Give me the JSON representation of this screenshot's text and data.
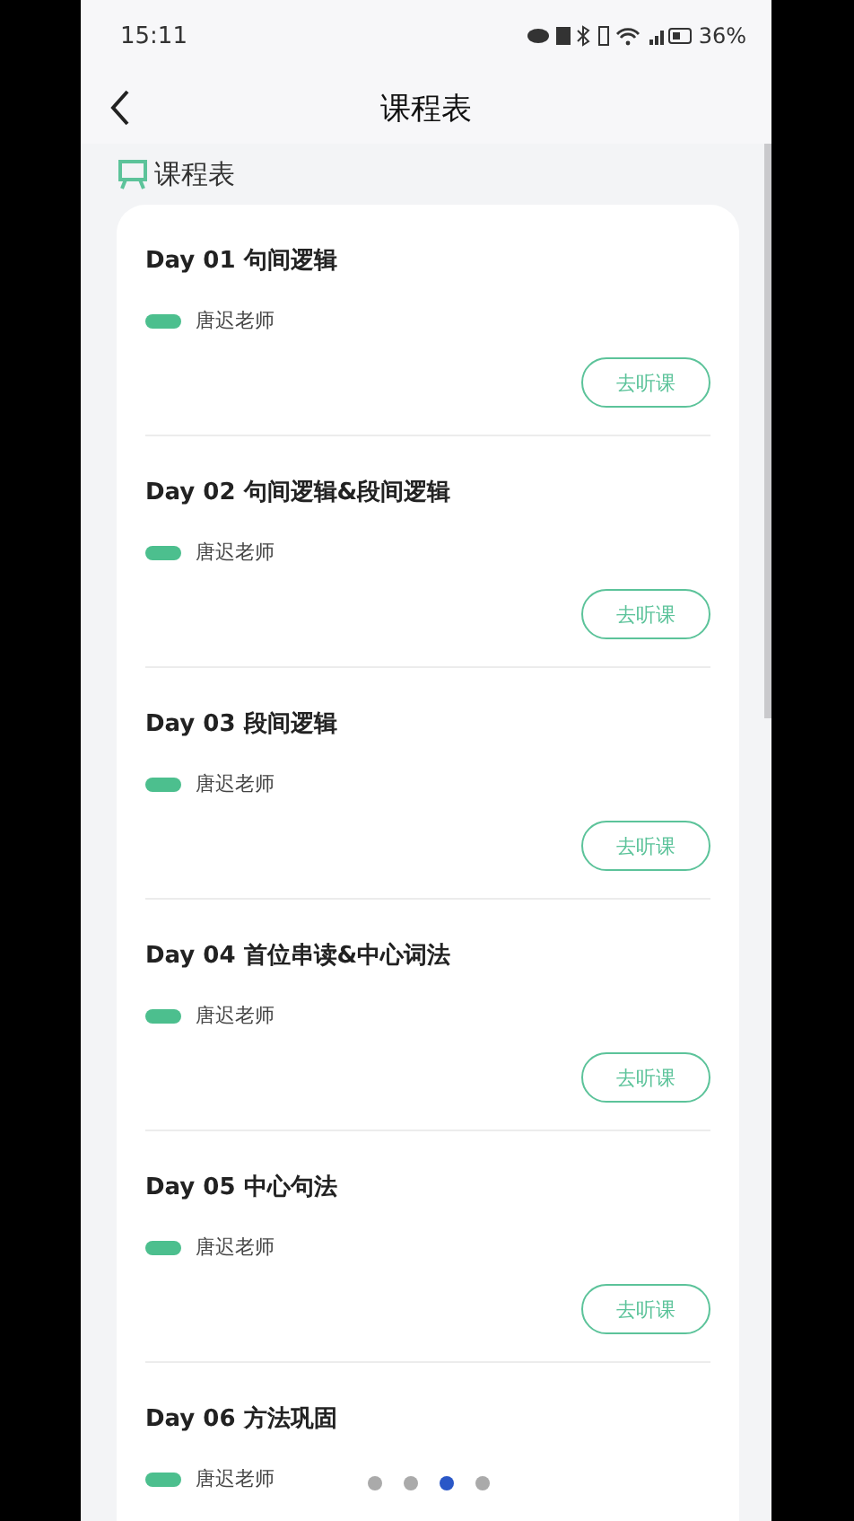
{
  "status_bar": {
    "time": "15:11",
    "battery": "36%"
  },
  "header": {
    "title": "课程表"
  },
  "section": {
    "title": "课程表"
  },
  "lessons": [
    {
      "title": "Day 01 句间逻辑",
      "teacher": "唐迟老师",
      "button": "去听课"
    },
    {
      "title": "Day 02 句间逻辑&段间逻辑",
      "teacher": "唐迟老师",
      "button": "去听课"
    },
    {
      "title": "Day 03 段间逻辑",
      "teacher": "唐迟老师",
      "button": "去听课"
    },
    {
      "title": "Day 04 首位串读&中心词法",
      "teacher": "唐迟老师",
      "button": "去听课"
    },
    {
      "title": "Day 05 中心句法",
      "teacher": "唐迟老师",
      "button": "去听课"
    },
    {
      "title": "Day 06 方法巩固",
      "teacher": "唐迟老师"
    }
  ],
  "pager": [
    {
      "selected": false
    },
    {
      "selected": false
    },
    {
      "selected": true
    },
    {
      "selected": false
    }
  ]
}
